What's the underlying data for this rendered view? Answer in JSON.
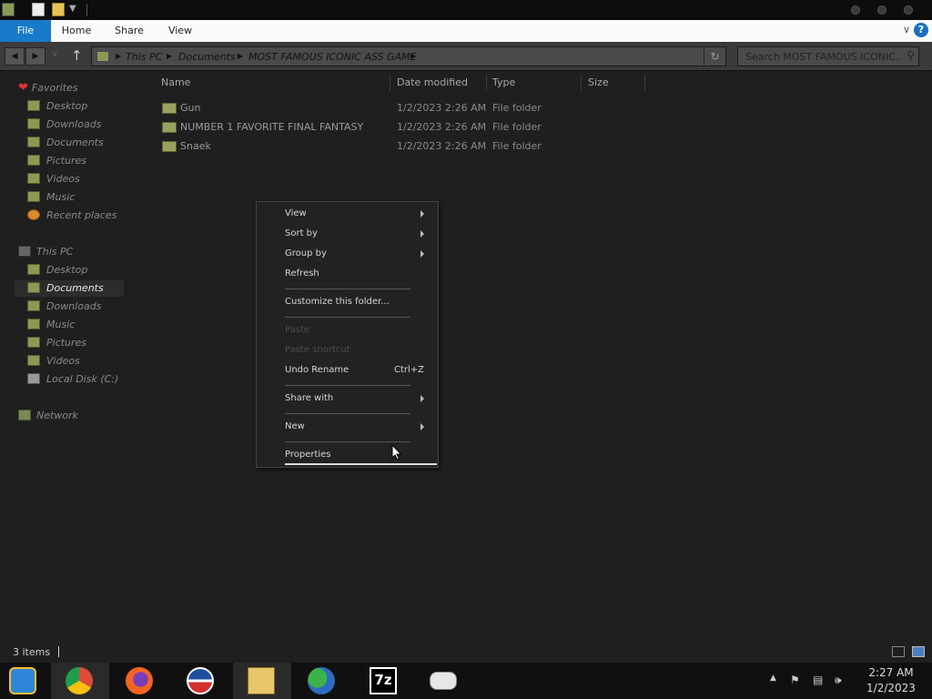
{
  "ribbon": {
    "tabs": [
      "File",
      "Home",
      "Share",
      "View"
    ]
  },
  "address": {
    "crumbs": [
      "This PC",
      "Documents",
      "MOST FAMOUS ICONIC ASS GAME"
    ]
  },
  "search": {
    "placeholder": "Search MOST FAMOUS ICONIC..."
  },
  "sidebar": {
    "favorites_label": "Favorites",
    "favorites": [
      "Desktop",
      "Downloads",
      "Documents",
      "Pictures",
      "Videos",
      "Music",
      "Recent places"
    ],
    "thispc_label": "This PC",
    "thispc": [
      "Desktop",
      "Documents",
      "Downloads",
      "Music",
      "Pictures",
      "Videos",
      "Local Disk (C:)"
    ],
    "network_label": "Network"
  },
  "columns": [
    "Name",
    "Date modified",
    "Type",
    "Size"
  ],
  "files": [
    {
      "name": "Gun",
      "date": "1/2/2023 2:26 AM",
      "type": "File folder",
      "size": ""
    },
    {
      "name": "NUMBER 1 FAVORITE FINAL FANTASY",
      "date": "1/2/2023 2:26 AM",
      "type": "File folder",
      "size": ""
    },
    {
      "name": "Snaek",
      "date": "1/2/2023 2:26 AM",
      "type": "File folder",
      "size": ""
    }
  ],
  "context_menu": {
    "view": "View",
    "sort_by": "Sort by",
    "group_by": "Group by",
    "refresh": "Refresh",
    "customize": "Customize this folder...",
    "paste": "Paste",
    "paste_shortcut": "Paste shortcut",
    "undo_rename": "Undo Rename",
    "undo_shortcut": "Ctrl+Z",
    "share_with": "Share with",
    "new": "New",
    "properties": "Properties"
  },
  "status": {
    "items": "3 items"
  },
  "taskbar": {
    "apps": [
      "start-orb-icon",
      "chrome-icon",
      "firefox-icon",
      "obama-logo-icon",
      "file-explorer-icon",
      "messenger-icon",
      "7zip-icon",
      "gamepad-icon"
    ],
    "sevenzip_label": "7z",
    "time": "2:27 AM",
    "date": "1/2/2023"
  },
  "colors": {
    "accent": "#1979ca",
    "background": "#1f1f1f",
    "folder": "#9aa160"
  }
}
